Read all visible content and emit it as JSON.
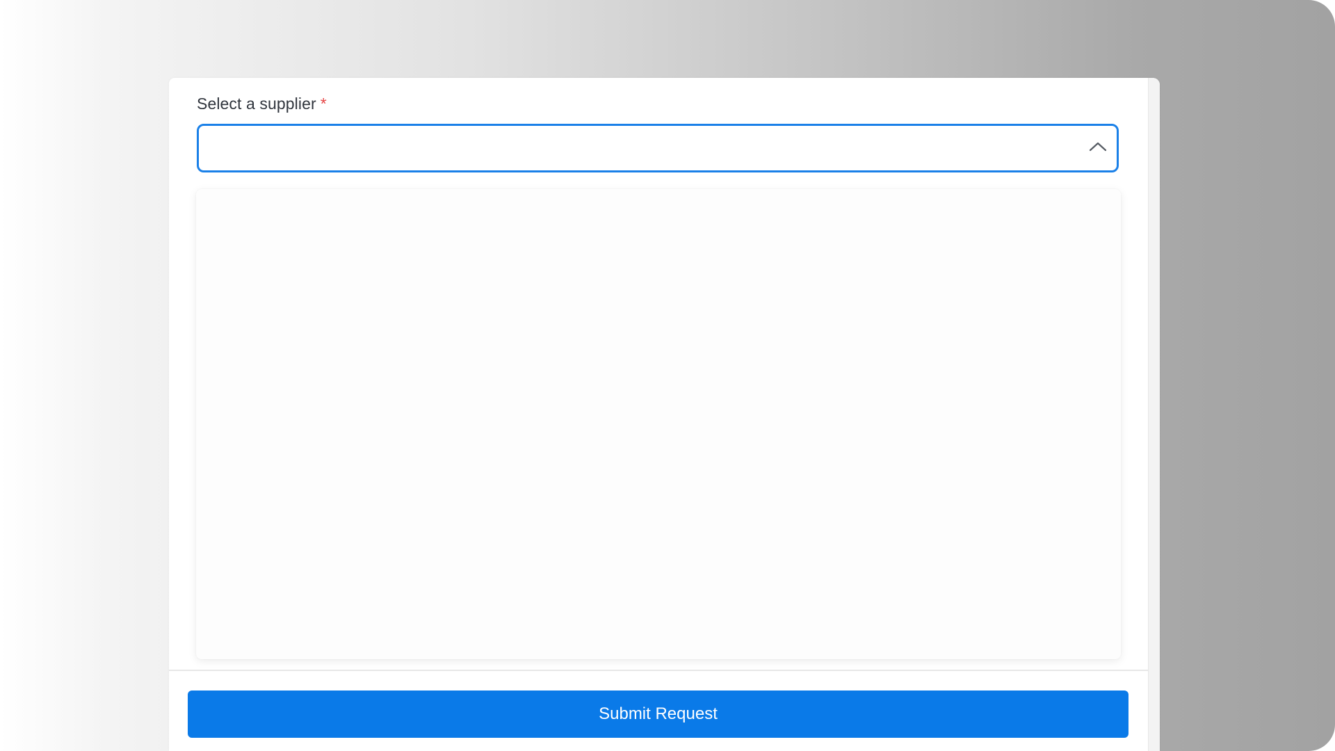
{
  "form": {
    "supplier_label": "Select a supplier",
    "required_marker": "*",
    "supplier_value": "",
    "dropdown_state": "expanded",
    "dropdown_options": [],
    "submit_label": "Submit Request"
  },
  "icons": {
    "dropdown_toggle": "chevron-up-icon"
  },
  "colors": {
    "accent": "#0a7ae8",
    "focus_border": "#1a80e8",
    "required": "#e64545",
    "label_text": "#30353d"
  }
}
